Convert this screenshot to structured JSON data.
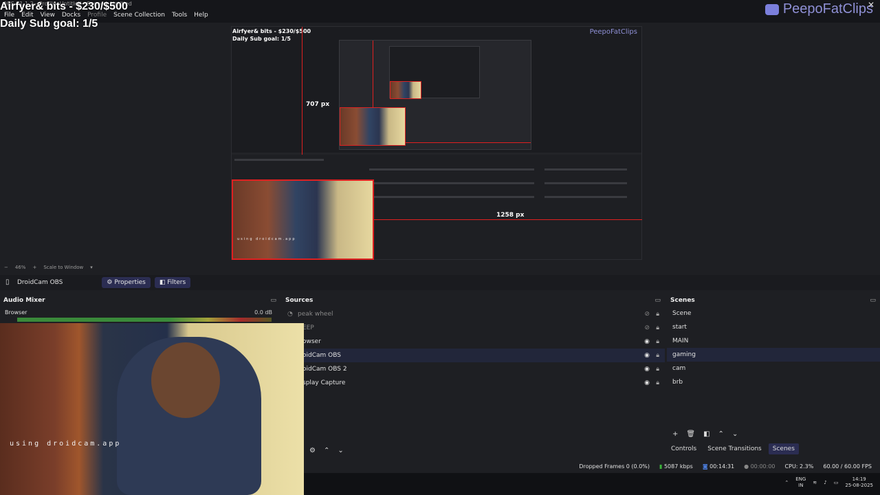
{
  "window": {
    "title": "OBS 31.1.2 - Profile: Untitled - Scenes: Untitled",
    "close": "✕"
  },
  "menu": [
    "File",
    "Edit",
    "View",
    "Docks",
    "Profile",
    "Scene Collection",
    "Tools",
    "Help"
  ],
  "overlay": {
    "bits": "Airfyer& bits - $230/$500",
    "sub_goal": "Daily Sub goal: 1/5",
    "brand": "PeepoFatClips"
  },
  "preview": {
    "inner_bits": "Airfyer& bits - $230/$500",
    "inner_sub": "Daily Sub goal: 1/5",
    "inner_brand": "PeepoFatClips",
    "height_px": "707 px",
    "width_px": "1258 px",
    "cam_label": "using droidcam.app"
  },
  "zoom": {
    "minus": "−",
    "value": "46%",
    "plus": "+",
    "mode": "Scale to Window"
  },
  "source_toolbar": {
    "source": "DroidCam OBS",
    "properties": "Properties",
    "filters": "Filters"
  },
  "mixer": {
    "title": "Audio Mixer",
    "channel": "Browser",
    "db": "0.0 dB"
  },
  "sources": {
    "title": "Sources",
    "items": [
      {
        "label": "peak wheel",
        "visible": false
      },
      {
        "label": "EEP",
        "visible": false
      },
      {
        "label": "owser",
        "visible": true
      },
      {
        "label": "oidCam OBS",
        "visible": true,
        "selected": true
      },
      {
        "label": "oidCam OBS 2",
        "visible": true
      },
      {
        "label": "splay Capture",
        "visible": true
      }
    ]
  },
  "scenes": {
    "title": "Scenes",
    "items": [
      "Scene",
      "start",
      "MAIN",
      "gaming",
      "cam",
      "brb"
    ],
    "selected": "gaming",
    "tabs": [
      "Controls",
      "Scene Transitions",
      "Scenes"
    ]
  },
  "webcam": {
    "label": "using droidcam.app"
  },
  "status": {
    "dropped": "Dropped Frames 0 (0.0%)",
    "kbps": "5087 kbps",
    "stream_time": "00:14:31",
    "rec_time": "00:00:00",
    "cpu": "CPU: 2.3%",
    "fps": "60.00 / 60.00 FPS"
  },
  "taskbar": {
    "lang1": "ENG",
    "lang2": "IN",
    "time": "14:19",
    "date": "25-08-2025"
  }
}
